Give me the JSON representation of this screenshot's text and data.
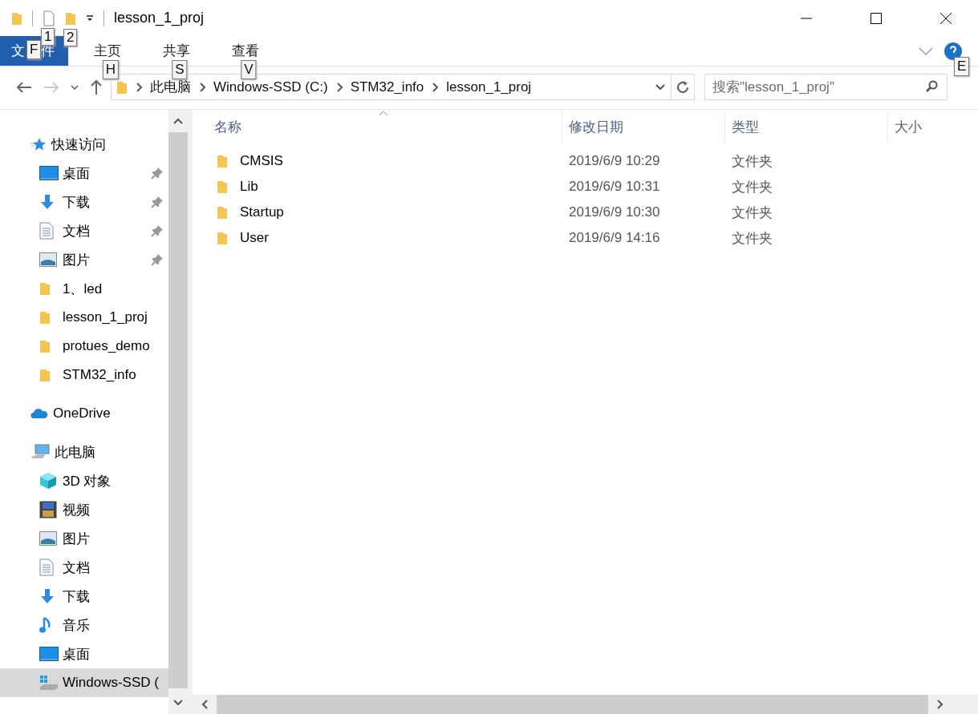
{
  "title_bar": {
    "quick_access": [
      {
        "kind": "file",
        "keytip": "1"
      },
      {
        "kind": "folder",
        "keytip": "2"
      }
    ],
    "title": "lesson_1_proj"
  },
  "ribbon": {
    "tabs": [
      {
        "label": "文件",
        "keytip": "F",
        "selected": true
      },
      {
        "label": "主页",
        "keytip": "H",
        "selected": false
      },
      {
        "label": "共享",
        "keytip": "S",
        "selected": false
      },
      {
        "label": "查看",
        "keytip": "V",
        "selected": false
      }
    ],
    "help_keytip": "E"
  },
  "address_bar": {
    "path": [
      "此电脑",
      "Windows-SSD (C:)",
      "STM32_info",
      "lesson_1_proj"
    ],
    "search": {
      "placeholder": "搜索\"lesson_1_proj\""
    }
  },
  "sidebar": {
    "groups": [
      {
        "label": "快速访问",
        "kind": "star",
        "items": [
          {
            "label": "桌面",
            "kind": "desktop",
            "pinned": true,
            "selected": false
          },
          {
            "label": "下载",
            "kind": "download",
            "pinned": true,
            "selected": false
          },
          {
            "label": "文档",
            "kind": "document",
            "pinned": true,
            "selected": false
          },
          {
            "label": "图片",
            "kind": "picture",
            "pinned": true,
            "selected": false
          },
          {
            "label": "1、led",
            "kind": "folder",
            "pinned": false,
            "selected": false
          },
          {
            "label": "lesson_1_proj",
            "kind": "folder",
            "pinned": false,
            "selected": false
          },
          {
            "label": "protues_demo",
            "kind": "folder",
            "pinned": false,
            "selected": false
          },
          {
            "label": "STM32_info",
            "kind": "folder",
            "pinned": false,
            "selected": false
          }
        ]
      },
      {
        "label": "OneDrive",
        "kind": "cloud"
      },
      {
        "label": "此电脑",
        "kind": "computer",
        "items": [
          {
            "label": "3D 对象",
            "kind": "cube",
            "pinned": false,
            "selected": false
          },
          {
            "label": "视频",
            "kind": "video",
            "pinned": false,
            "selected": false
          },
          {
            "label": "图片",
            "kind": "picture",
            "pinned": false,
            "selected": false
          },
          {
            "label": "文档",
            "kind": "document",
            "pinned": false,
            "selected": false
          },
          {
            "label": "下载",
            "kind": "download",
            "pinned": false,
            "selected": false
          },
          {
            "label": "音乐",
            "kind": "music",
            "pinned": false,
            "selected": false
          },
          {
            "label": "桌面",
            "kind": "desktop",
            "pinned": false,
            "selected": false
          },
          {
            "label": "Windows-SSD (",
            "kind": "drive",
            "pinned": false,
            "selected": true
          }
        ]
      }
    ]
  },
  "file_list": {
    "columns": [
      "名称",
      "修改日期",
      "类型",
      "大小"
    ],
    "rows": [
      {
        "name": "CMSIS",
        "modified": "2019/6/9 10:29",
        "type": "文件夹"
      },
      {
        "name": "Lib",
        "modified": "2019/6/9 10:31",
        "type": "文件夹"
      },
      {
        "name": "Startup",
        "modified": "2019/6/9 10:30",
        "type": "文件夹"
      },
      {
        "name": "User",
        "modified": "2019/6/9 14:16",
        "type": "文件夹"
      }
    ]
  }
}
